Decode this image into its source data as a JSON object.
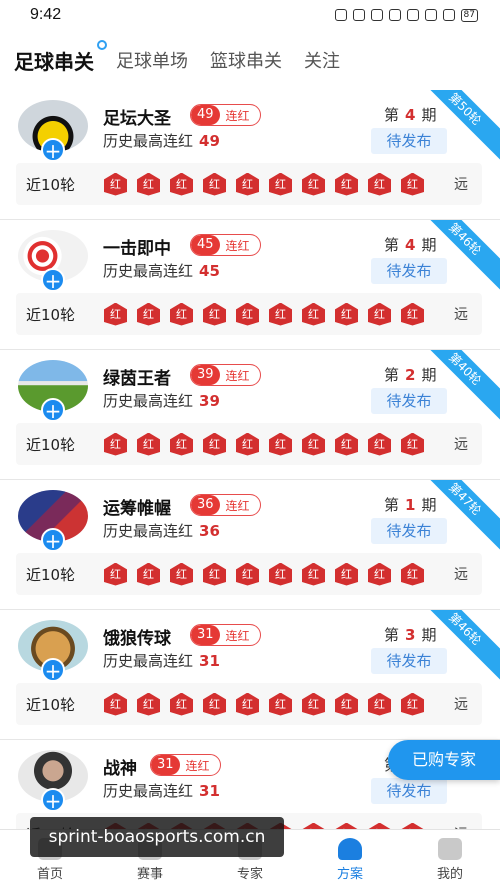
{
  "status": {
    "time": "9:42",
    "battery": "87"
  },
  "tabs": [
    {
      "label": "足球串关"
    },
    {
      "label": "足球单场"
    },
    {
      "label": "篮球串关"
    },
    {
      "label": "关注"
    }
  ],
  "experts": [
    {
      "name": "足坛大圣",
      "streak": "49",
      "streak_label": "连红",
      "history_label": "历史最高连红",
      "history_value": "49",
      "period_pre": "第",
      "period": "4",
      "period_post": "期",
      "status": "待发布",
      "ribbon": "第50轮",
      "recent_label": "近10轮",
      "badges": [
        "红",
        "红",
        "红",
        "红",
        "红",
        "红",
        "红",
        "红",
        "红",
        "红"
      ],
      "more": "远"
    },
    {
      "name": "一击即中",
      "streak": "45",
      "streak_label": "连红",
      "history_label": "历史最高连红",
      "history_value": "45",
      "period_pre": "第",
      "period": "4",
      "period_post": "期",
      "status": "待发布",
      "ribbon": "第46轮",
      "recent_label": "近10轮",
      "badges": [
        "红",
        "红",
        "红",
        "红",
        "红",
        "红",
        "红",
        "红",
        "红",
        "红"
      ],
      "more": "远"
    },
    {
      "name": "绿茵王者",
      "streak": "39",
      "streak_label": "连红",
      "history_label": "历史最高连红",
      "history_value": "39",
      "period_pre": "第",
      "period": "2",
      "period_post": "期",
      "status": "待发布",
      "ribbon": "第40轮",
      "recent_label": "近10轮",
      "badges": [
        "红",
        "红",
        "红",
        "红",
        "红",
        "红",
        "红",
        "红",
        "红",
        "红"
      ],
      "more": "远"
    },
    {
      "name": "运筹帷幄",
      "streak": "36",
      "streak_label": "连红",
      "history_label": "历史最高连红",
      "history_value": "36",
      "period_pre": "第",
      "period": "1",
      "period_post": "期",
      "status": "待发布",
      "ribbon": "第47轮",
      "recent_label": "近10轮",
      "badges": [
        "红",
        "红",
        "红",
        "红",
        "红",
        "红",
        "红",
        "红",
        "红",
        "红"
      ],
      "more": "远"
    },
    {
      "name": "饿狼传球",
      "streak": "31",
      "streak_label": "连红",
      "history_label": "历史最高连红",
      "history_value": "31",
      "period_pre": "第",
      "period": "3",
      "period_post": "期",
      "status": "待发布",
      "ribbon": "第46轮",
      "recent_label": "近10轮",
      "badges": [
        "红",
        "红",
        "红",
        "红",
        "红",
        "红",
        "红",
        "红",
        "红",
        "红"
      ],
      "more": "远"
    },
    {
      "name": "战神",
      "streak": "31",
      "streak_label": "连红",
      "history_label": "历史最高连红",
      "history_value": "31",
      "period_pre": "第",
      "period": "",
      "period_post": "",
      "status": "待发布",
      "ribbon": "",
      "recent_label": "近10轮",
      "badges": [
        "红",
        "红",
        "红",
        "红",
        "红",
        "红",
        "红",
        "红",
        "红",
        "红"
      ],
      "more": "远"
    }
  ],
  "float_button": "已购专家",
  "bottom_nav": [
    {
      "label": "首页"
    },
    {
      "label": "赛事"
    },
    {
      "label": "专家"
    },
    {
      "label": "方案"
    },
    {
      "label": "我的"
    }
  ],
  "watermark": "sprint-boaosports.com.cn",
  "colors": {
    "accent": "#1b8bef",
    "red": "#d32f2f"
  }
}
